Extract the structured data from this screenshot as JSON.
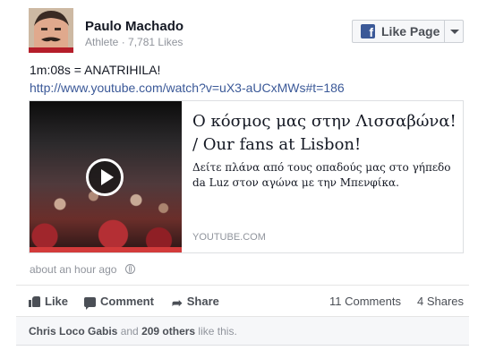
{
  "author": {
    "name": "Paulo Machado",
    "category": "Athlete",
    "likes": "7,781 Likes"
  },
  "like_page_button": {
    "label": "Like Page",
    "brand_color": "#3b5998"
  },
  "post": {
    "text": "1m:08s = ANATRIHILA!",
    "link": "http://www.youtube.com/watch?v=uX3-aUCxMWs#t=186",
    "timestamp": "about an hour ago",
    "privacy_icon": "globe-icon"
  },
  "share_card": {
    "title": "Ο κόσμος μας στην Λισσαβώνα! / Our fans at Lisbon!",
    "description": "Δείτε πλάνα από τους οπαδούς μας στο γήπεδο da Luz στον αγώνα με την Μπενφίκα.",
    "domain": "YOUTUBE.COM",
    "thumbnail_icon": "play-icon"
  },
  "actions": {
    "like": "Like",
    "comment": "Comment",
    "share": "Share"
  },
  "counts": {
    "comments": "11 Comments",
    "shares": "4 Shares"
  },
  "likes_summary": {
    "person": "Chris Loco Gabis",
    "joiner": " and ",
    "others": "209 others",
    "suffix": " like this."
  }
}
